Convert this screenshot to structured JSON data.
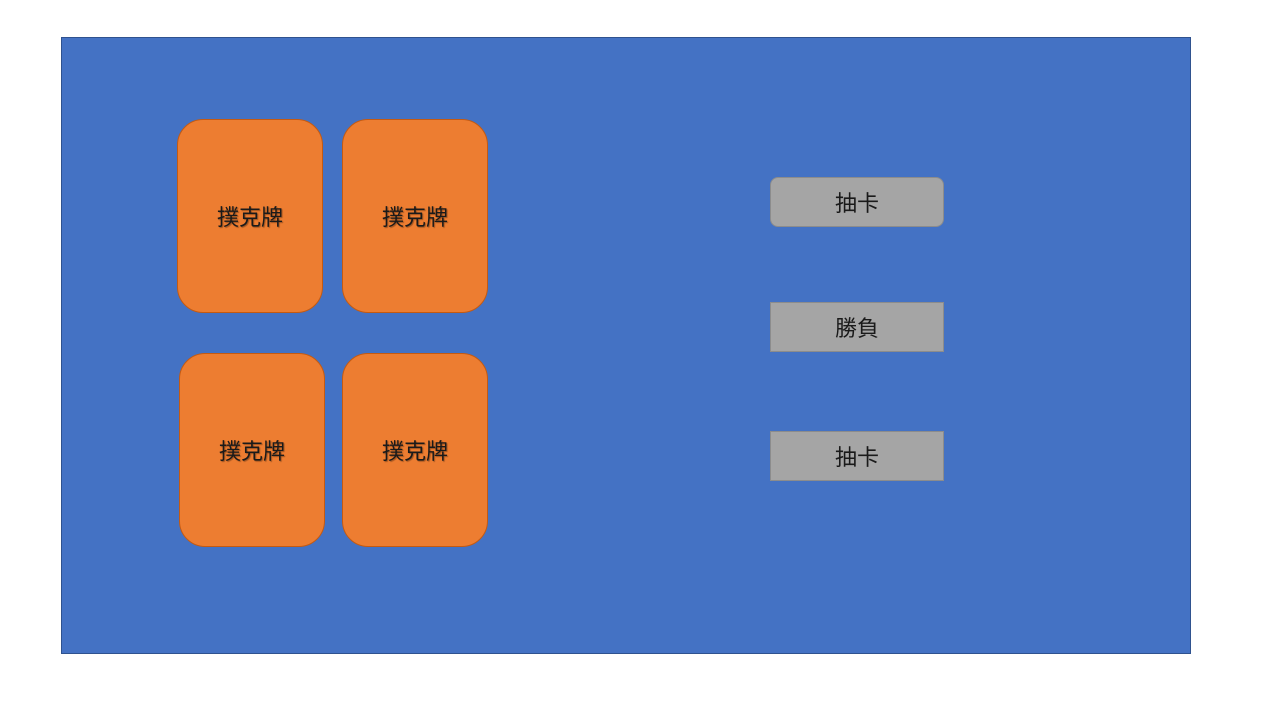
{
  "colors": {
    "page_background": "#ffffff",
    "table_background": "#4472c4",
    "card_fill": "#ed7d31",
    "button_fill": "#a5a5a5"
  },
  "cards": [
    {
      "label": "撲克牌"
    },
    {
      "label": "撲克牌"
    },
    {
      "label": "撲克牌"
    },
    {
      "label": "撲克牌"
    }
  ],
  "buttons": {
    "draw_top": "抽卡",
    "result": "勝負",
    "draw_bottom": "抽卡"
  }
}
